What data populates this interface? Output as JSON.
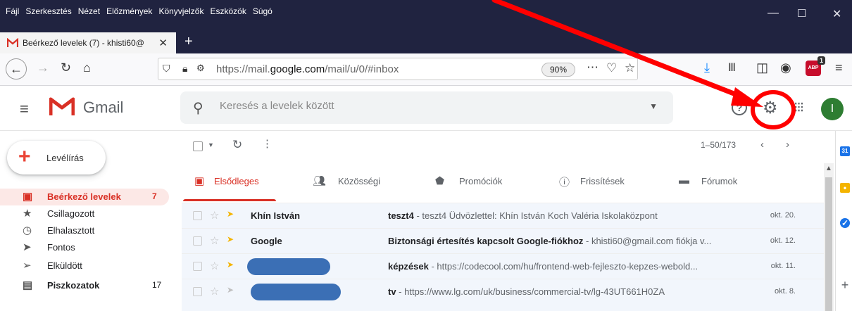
{
  "browser": {
    "menu": [
      "Fájl",
      "Szerkesztés",
      "Nézet",
      "Előzmények",
      "Könyvjelzők",
      "Eszközök",
      "Súgó"
    ],
    "window_controls": {
      "minimize": "—",
      "maximize": "☐",
      "close": "✕"
    },
    "tab": {
      "title": "Beérkező levelek (7) - khisti60@",
      "close": "✕"
    },
    "new_tab": "+",
    "url": {
      "scheme": "https://mail.",
      "host": "google.com",
      "path": "/mail/u/0/#inbox"
    },
    "zoom": "90%",
    "abp_badge": "1",
    "abp_label": "ABP"
  },
  "gmail": {
    "product_name": "Gmail",
    "search_placeholder": "Keresés a levelek között",
    "avatar_initial": "I",
    "compose_label": "Levélírás",
    "nav": [
      {
        "label": "Beérkező levelek",
        "count": "7",
        "icon": "inbox-icon"
      },
      {
        "label": "Csillagozott",
        "count": "",
        "icon": "star-icon"
      },
      {
        "label": "Elhalasztott",
        "count": "",
        "icon": "clock-icon"
      },
      {
        "label": "Fontos",
        "count": "",
        "icon": "important-icon"
      },
      {
        "label": "Elküldött",
        "count": "",
        "icon": "send-icon"
      },
      {
        "label": "Piszkozatok",
        "count": "17",
        "icon": "draft-icon"
      }
    ],
    "pagination": "1–50/173",
    "categories": [
      "Elsődleges",
      "Közösségi",
      "Promóciók",
      "Frissítések",
      "Fórumok"
    ],
    "emails": [
      {
        "sender": "Khín István",
        "subject": "teszt4",
        "snippet": " - teszt4 Üdvözlettel: Khín István Koch Valéria Iskolaközpont",
        "date": "okt. 20.",
        "redacted": false,
        "importance": "yellow"
      },
      {
        "sender": "Google",
        "subject": "Biztonsági értesítés kapcsolt Google-fiókhoz",
        "snippet": " - khisti60@gmail.com fiókja v...",
        "date": "okt. 12.",
        "redacted": false,
        "importance": "yellow"
      },
      {
        "sender": "",
        "subject": "képzések",
        "snippet": " - https://codecool.com/hu/frontend-web-fejleszto-kepzes-webold...",
        "date": "okt. 11.",
        "redacted": true,
        "importance": "yellow"
      },
      {
        "sender": "",
        "subject": "tv",
        "snippet": " - https://www.lg.com/uk/business/commercial-tv/lg-43UT661H0ZA",
        "date": "okt. 8.",
        "redacted": true,
        "importance": "faint"
      }
    ],
    "side_panel_plus": "+"
  },
  "colors": {
    "accent": "#d93025",
    "annotation": "#ff0000",
    "chrome": "#202340"
  }
}
